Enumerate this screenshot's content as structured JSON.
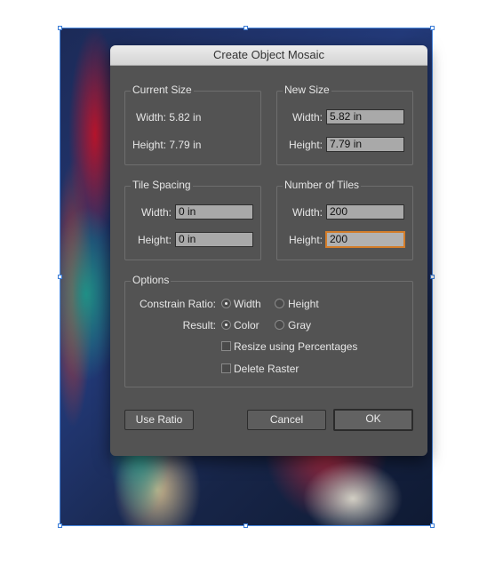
{
  "dialog": {
    "title": "Create Object Mosaic"
  },
  "current_size": {
    "title": "Current Size",
    "width_label": "Width:",
    "width_value": "5.82 in",
    "height_label": "Height:",
    "height_value": "7.79 in"
  },
  "new_size": {
    "title": "New Size",
    "width_label": "Width:",
    "width_value": "5.82 in",
    "height_label": "Height:",
    "height_value": "7.79 in"
  },
  "tile_spacing": {
    "title": "Tile Spacing",
    "width_label": "Width:",
    "width_value": "0 in",
    "height_label": "Height:",
    "height_value": "0 in"
  },
  "number_of_tiles": {
    "title": "Number of Tiles",
    "width_label": "Width:",
    "width_value": "200",
    "height_label": "Height:",
    "height_value": "200"
  },
  "options": {
    "title": "Options",
    "constrain_label": "Constrain Ratio:",
    "constrain_width": "Width",
    "constrain_height": "Height",
    "constrain_selected": "Width",
    "result_label": "Result:",
    "result_color": "Color",
    "result_gray": "Gray",
    "result_selected": "Color",
    "resize_percentages": "Resize using Percentages",
    "resize_checked": false,
    "delete_raster": "Delete Raster",
    "delete_checked": false
  },
  "buttons": {
    "use_ratio": "Use Ratio",
    "cancel": "Cancel",
    "ok": "OK"
  },
  "colors": {
    "dialog_bg": "#535353",
    "field_bg": "#a9a9a9",
    "focus": "#d37d2a",
    "selection": "#4a8ae0"
  }
}
